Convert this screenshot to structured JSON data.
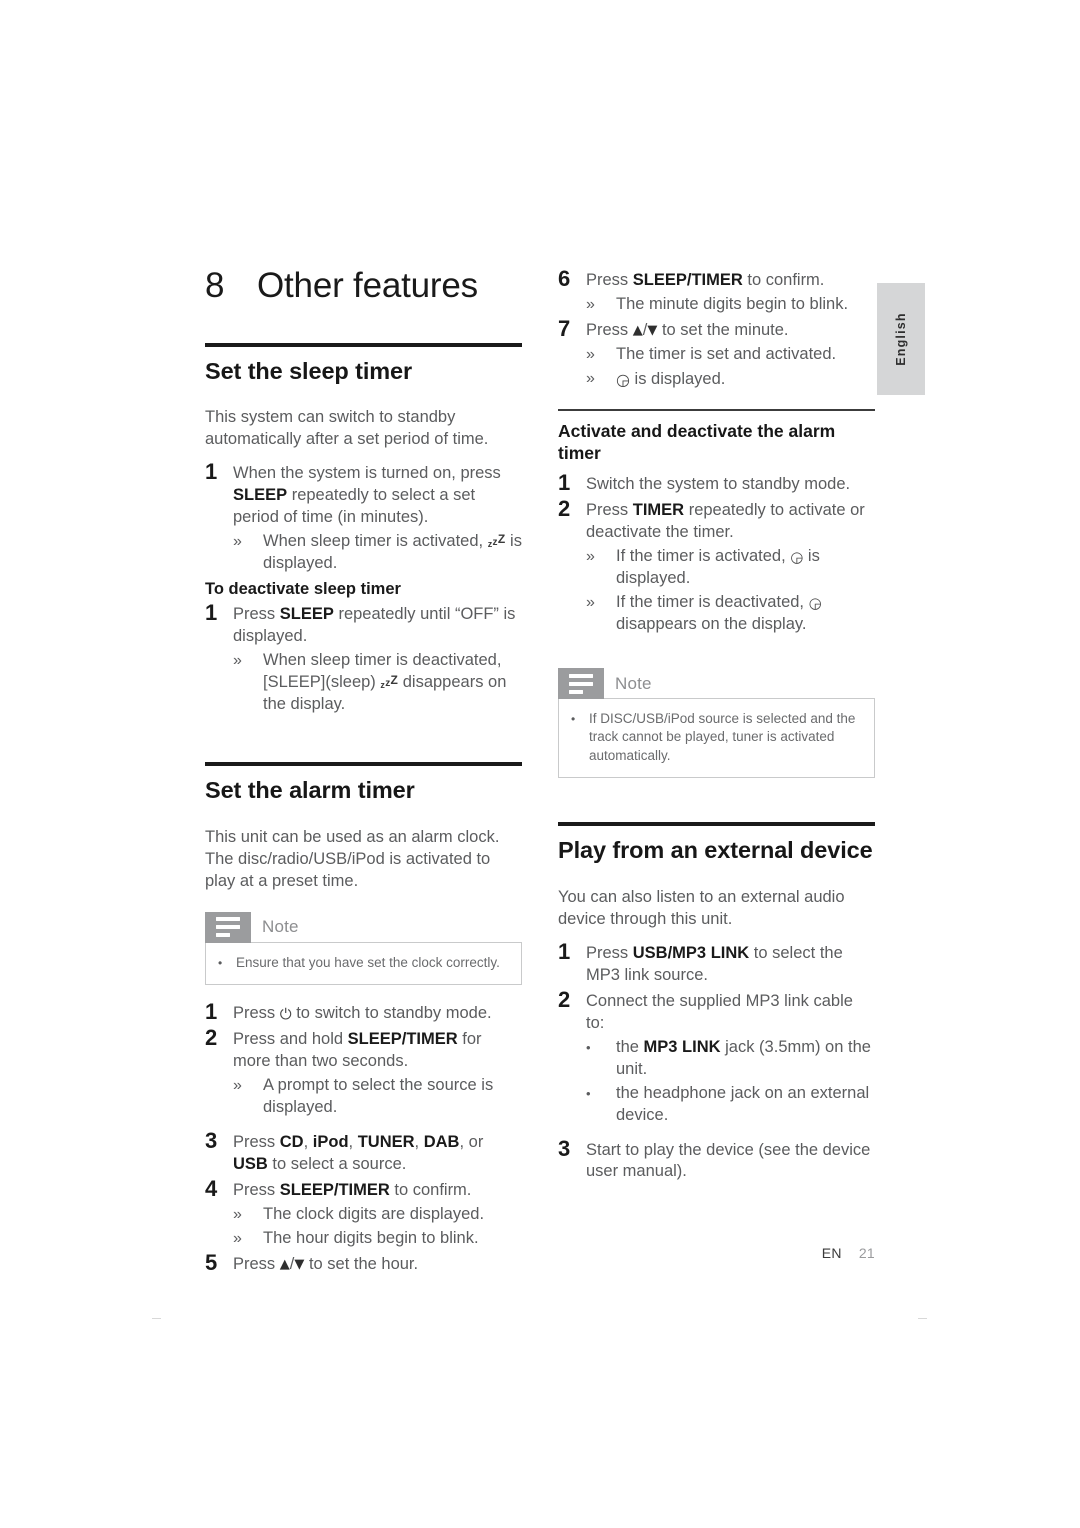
{
  "page": {
    "chapter_number": "8",
    "chapter_title": "Other features",
    "language_tab": "English",
    "footer_code": "EN",
    "footer_page": "21"
  },
  "glyphs": {
    "sleep_z1": "z",
    "sleep_z2": "z",
    "sleep_z3": "Z",
    "power": "⏻",
    "up_triangle": "▲",
    "down_triangle": "▼",
    "separator": "/",
    "clock": "◶",
    "alarm": "⏰",
    "guillemet": "»",
    "bullet": "•",
    "note_icon": "note-lines-icon"
  },
  "sections": {
    "sleep_timer": {
      "heading": "Set the sleep timer",
      "intro": "This system can switch to standby automatically after a set period of time.",
      "step1": {
        "num": "1",
        "text_a": "When the system is turned on, press ",
        "bold_b": "SLEEP",
        "text_c": " repeatedly to select a set period of time (in minutes).",
        "result_a": "When sleep timer is activated, ",
        "result_b": " is displayed."
      },
      "deactivate_heading": "To deactivate sleep timer",
      "deactivate_step": {
        "num": "1",
        "text_a": "Press ",
        "bold_b": "SLEEP",
        "text_c": " repeatedly until “OFF” is displayed.",
        "result_a": "When sleep timer is deactivated, [SLEEP](sleep) ",
        "result_b": " disappears on the display."
      }
    },
    "alarm_timer": {
      "heading": "Set the alarm timer",
      "intro": "This unit can be used as an alarm clock. The disc/radio/USB/iPod is activated to play at a preset time.",
      "note": {
        "label": "Note",
        "items": [
          "Ensure that you have set the clock correctly."
        ]
      },
      "steps": [
        {
          "num": "1",
          "text_a": "Press ",
          "glyph": "power",
          "text_c": " to switch to standby mode."
        },
        {
          "num": "2",
          "text_a": "Press and hold ",
          "bold_b": "SLEEP/TIMER",
          "text_c": " for more than two seconds.",
          "results": [
            "A prompt to select the source is displayed."
          ]
        },
        {
          "num": "3",
          "text_a": "Press ",
          "bold_parts": [
            "CD",
            "iPod",
            "TUNER",
            "DAB",
            "USB"
          ],
          "text_c": " to select a source.",
          "full_text": "Press CD, iPod, TUNER, DAB, or USB to select a source."
        },
        {
          "num": "4",
          "text_a": "Press ",
          "bold_b": "SLEEP/TIMER",
          "text_c": " to confirm.",
          "results": [
            "The clock digits are displayed.",
            "The hour digits begin to blink."
          ]
        },
        {
          "num": "5",
          "text_a": "Press ",
          "text_c": " to set the hour."
        },
        {
          "num": "6",
          "text_a": "Press ",
          "bold_b": "SLEEP/TIMER",
          "text_c": " to confirm.",
          "results": [
            "The minute digits begin to blink."
          ]
        },
        {
          "num": "7",
          "text_a": "Press ",
          "text_c": " to set the minute.",
          "results": [
            "The timer is set and activated."
          ],
          "result_glyph_suffix": " is displayed."
        }
      ]
    },
    "activate_deactivate": {
      "heading": "Activate and deactivate the alarm timer",
      "steps": [
        {
          "num": "1",
          "text": "Switch the system to standby mode."
        },
        {
          "num": "2",
          "text_a": "Press ",
          "bold_b": "TIMER",
          "text_c": " repeatedly to activate or deactivate the timer.",
          "result_activated_a": "If the timer is activated, ",
          "result_activated_b": " is displayed.",
          "result_deactivated_a": "If the timer is deactivated, ",
          "result_deactivated_b": " disappears on the display."
        }
      ],
      "note": {
        "label": "Note",
        "items": [
          "If DISC/USB/iPod source is selected and the track cannot be played, tuner is activated automatically."
        ]
      }
    },
    "external_device": {
      "heading": "Play from an external device",
      "intro": "You can also listen to an external audio device through this unit.",
      "steps": [
        {
          "num": "1",
          "text_a": "Press ",
          "bold_b": "USB/MP3 LINK",
          "text_c": " to select the MP3 link source."
        },
        {
          "num": "2",
          "text_a": "Connect the supplied MP3 link cable to:",
          "bullets_a": "the ",
          "bullets_bold": "MP3 LINK",
          "bullets_c": " jack (3.5mm) on the unit.",
          "bullet_two": "the headphone jack on an external device."
        },
        {
          "num": "3",
          "text_a": "Start to play the device (see the device user manual)."
        }
      ]
    }
  },
  "colors": {
    "body_text": "#5b5c5e",
    "heading_text": "#171717",
    "rule": "#1a1a1a",
    "note_tab": "#9b9c9e",
    "note_border": "#c9cacb",
    "side_tab": "#d5d6d7"
  }
}
